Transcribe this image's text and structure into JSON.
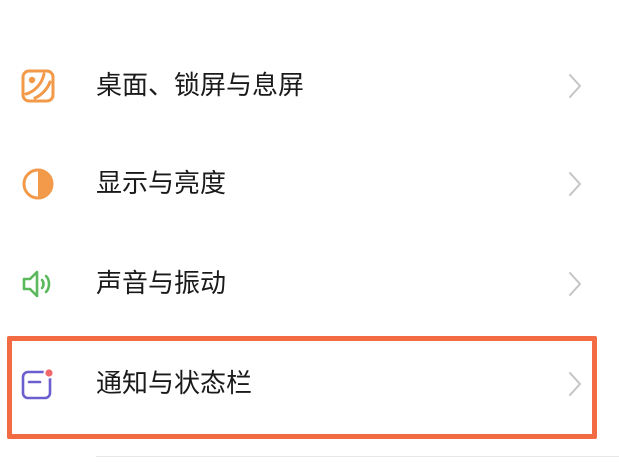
{
  "settings": {
    "items": [
      {
        "label": "桌面、锁屏与息屏",
        "icon": "wallpaper-icon",
        "color": "#f2994a"
      },
      {
        "label": "显示与亮度",
        "icon": "brightness-icon",
        "color": "#f2994a"
      },
      {
        "label": "声音与振动",
        "icon": "speaker-icon",
        "color": "#5cb85c"
      },
      {
        "label": "通知与状态栏",
        "icon": "notification-icon",
        "color": "#6b5fcf"
      }
    ],
    "highlight_color": "#f26b43"
  }
}
